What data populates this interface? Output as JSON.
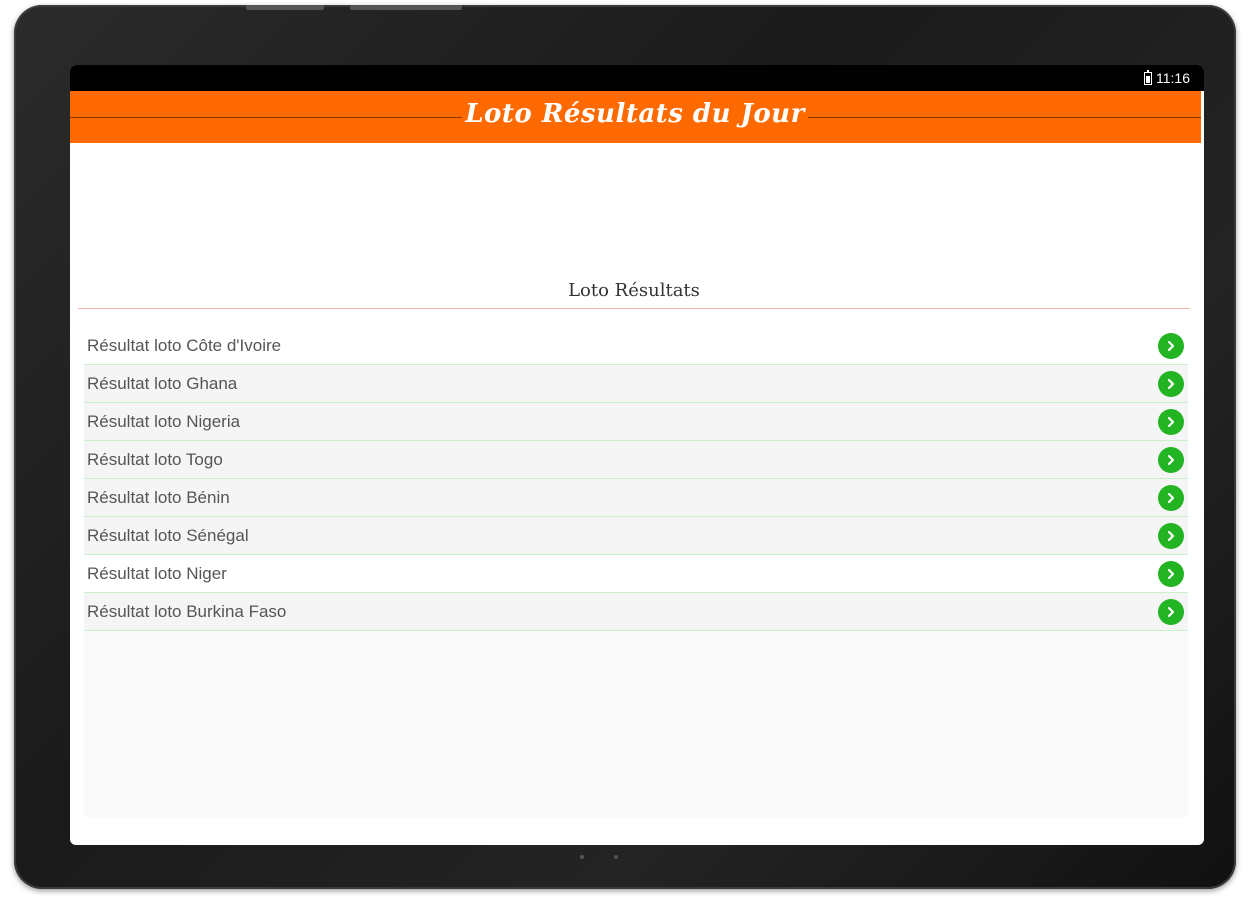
{
  "status_bar": {
    "time": "11:16"
  },
  "app_bar": {
    "title": "Loto Résultats du Jour"
  },
  "section": {
    "title": "Loto Résultats"
  },
  "list": {
    "items": [
      {
        "label": "Résultat loto Côte d'Ivoire"
      },
      {
        "label": "Résultat loto Ghana"
      },
      {
        "label": "Résultat loto Nigeria"
      },
      {
        "label": "Résultat loto Togo"
      },
      {
        "label": "Résultat loto Bénin"
      },
      {
        "label": "Résultat loto Sénégal"
      },
      {
        "label": "Résultat loto Niger"
      },
      {
        "label": "Résultat loto Burkina Faso"
      }
    ]
  },
  "colors": {
    "app_bar": "#ff6a00",
    "chevron": "#22b422",
    "divider": "#c9f0c9"
  },
  "icons": {
    "battery": "battery-icon",
    "row_action": "chevron-right-icon"
  }
}
